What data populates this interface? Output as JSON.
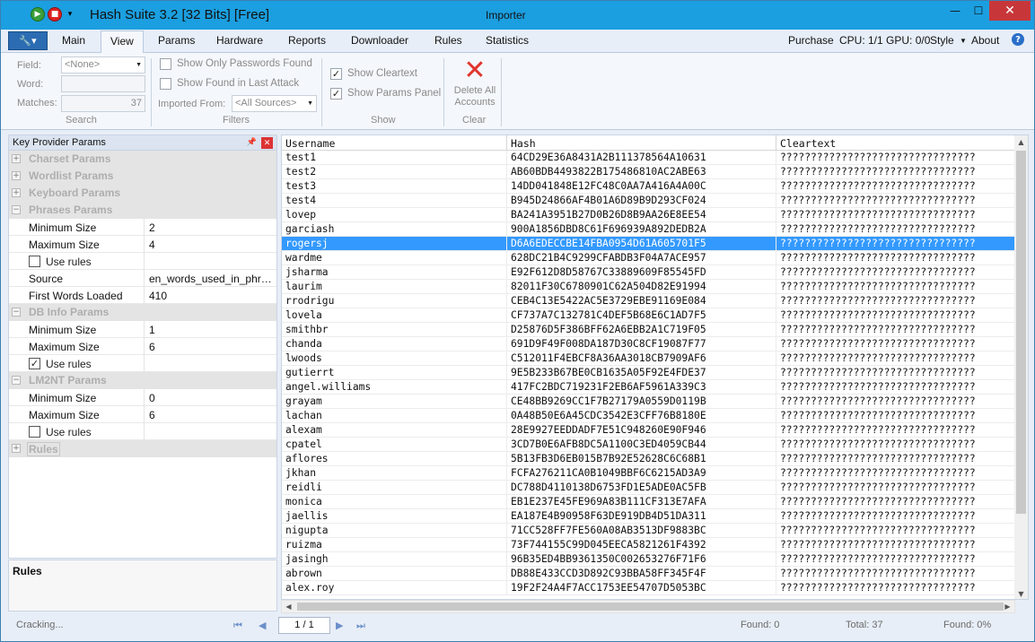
{
  "titlebar": {
    "app_title": "Hash Suite 3.2 [32 Bits] [Free]",
    "center_title": "Importer",
    "minimize": "—",
    "maximize": "☐",
    "close": "✕"
  },
  "menu": {
    "app_button_icon": "key-icon",
    "tabs": [
      "Main",
      "View",
      "Params",
      "Hardware",
      "Reports",
      "Downloader",
      "Rules",
      "Statistics"
    ],
    "active_tab": "View",
    "purchase": "Purchase",
    "cpu_gpu": "CPU: 1/1 GPU: 0/0",
    "style": "Style",
    "about": "About",
    "help": "?"
  },
  "ribbon": {
    "search": {
      "field_label": "Field:",
      "field_value": "<None>",
      "word_label": "Word:",
      "word_value": "",
      "matches_label": "Matches:",
      "matches_value": "37",
      "group": "Search"
    },
    "filters": {
      "show_only_found": "Show Only Passwords Found",
      "show_only_found_checked": false,
      "show_found_last": "Show Found in Last Attack",
      "show_found_last_checked": false,
      "imported_from_label": "Imported From:",
      "imported_from_value": "<All Sources>",
      "group": "Filters"
    },
    "show": {
      "show_cleartext": "Show Cleartext",
      "show_cleartext_checked": true,
      "show_params_panel": "Show Params Panel",
      "show_params_panel_checked": true,
      "group": "Show"
    },
    "clear": {
      "delete_line1": "Delete All",
      "delete_line2": "Accounts",
      "group": "Clear"
    }
  },
  "left_panel": {
    "title": "Key Provider Params",
    "rows": [
      {
        "type": "cat",
        "name": "Charset Params",
        "expander": "+"
      },
      {
        "type": "cat",
        "name": "Wordlist Params",
        "expander": "+"
      },
      {
        "type": "cat",
        "name": "Keyboard Params",
        "expander": "+"
      },
      {
        "type": "cat",
        "name": "Phrases Params",
        "expander": "−"
      },
      {
        "type": "prop",
        "name": "Minimum Size",
        "value": "2"
      },
      {
        "type": "prop",
        "name": "Maximum Size",
        "value": "4"
      },
      {
        "type": "check",
        "name": "Use rules",
        "checked": false
      },
      {
        "type": "prop",
        "name": "Source",
        "value": "en_words_used_in_phrases.lst"
      },
      {
        "type": "prop",
        "name": "First Words Loaded",
        "value": "410"
      },
      {
        "type": "cat",
        "name": "DB Info Params",
        "expander": "−"
      },
      {
        "type": "prop",
        "name": "Minimum Size",
        "value": "1"
      },
      {
        "type": "prop",
        "name": "Maximum Size",
        "value": "6"
      },
      {
        "type": "check",
        "name": "Use rules",
        "checked": true
      },
      {
        "type": "cat",
        "name": "LM2NT Params",
        "expander": "−"
      },
      {
        "type": "prop",
        "name": "Minimum Size",
        "value": "0"
      },
      {
        "type": "prop",
        "name": "Maximum Size",
        "value": "6"
      },
      {
        "type": "check",
        "name": "Use rules",
        "checked": false
      },
      {
        "type": "rulescat",
        "name": "Rules",
        "expander": "+"
      }
    ],
    "bottom_title": "Rules"
  },
  "table": {
    "columns": [
      "Username",
      "Hash",
      "Cleartext"
    ],
    "selected_index": 6,
    "rows": [
      [
        "test1",
        "64CD29E36A8431A2B111378564A10631",
        "????????????????????????????????"
      ],
      [
        "test2",
        "AB60BDB4493822B175486810AC2ABE63",
        "????????????????????????????????"
      ],
      [
        "test3",
        "14DD041848E12FC48C0AA7A416A4A00C",
        "????????????????????????????????"
      ],
      [
        "test4",
        "B945D24866AF4B01A6D89B9D293CF024",
        "????????????????????????????????"
      ],
      [
        "lovep",
        "BA241A3951B27D0B26D8B9AA26E8EE54",
        "????????????????????????????????"
      ],
      [
        "garciash",
        "900A1856DBD8C61F696939A892DEDB2A",
        "????????????????????????????????"
      ],
      [
        "rogersj",
        "D6A6EDECCBE14FBA0954D61A605701F5",
        "????????????????????????????????"
      ],
      [
        "wardme",
        "628DC21B4C9299CFABDB3F04A7ACE957",
        "????????????????????????????????"
      ],
      [
        "jsharma",
        "E92F612D8D58767C33889609F85545FD",
        "????????????????????????????????"
      ],
      [
        "laurim",
        "82011F30C6780901C62A504D82E91994",
        "????????????????????????????????"
      ],
      [
        "rrodrigu",
        "CEB4C13E5422AC5E3729EBE91169E084",
        "????????????????????????????????"
      ],
      [
        "lovela",
        "CF737A7C132781C4DEF5B68E6C1AD7F5",
        "????????????????????????????????"
      ],
      [
        "smithbr",
        "D25876D5F386BFF62A6EBB2A1C719F05",
        "????????????????????????????????"
      ],
      [
        "chanda",
        "691D9F49F008DA187D30C8CF19087F77",
        "????????????????????????????????"
      ],
      [
        "lwoods",
        "C512011F4EBCF8A36AA3018CB7909AF6",
        "????????????????????????????????"
      ],
      [
        "gutierrt",
        "9E5B233B67BE0CB1635A05F92E4FDE37",
        "????????????????????????????????"
      ],
      [
        "angel.williams",
        "417FC2BDC719231F2EB6AF5961A339C3",
        "????????????????????????????????"
      ],
      [
        "grayam",
        "CE48BB9269CC1F7B27179A0559D0119B",
        "????????????????????????????????"
      ],
      [
        "lachan",
        "0A48B50E6A45CDC3542E3CFF76B8180E",
        "????????????????????????????????"
      ],
      [
        "alexam",
        "28E9927EEDDADF7E51C948260E90F946",
        "????????????????????????????????"
      ],
      [
        "cpatel",
        "3CD7B0E6AFB8DC5A1100C3ED4059CB44",
        "????????????????????????????????"
      ],
      [
        "aflores",
        "5B13FB3D6EB015B7B92E52628C6C68B1",
        "????????????????????????????????"
      ],
      [
        "jkhan",
        "FCFA276211CA0B1049BBF6C6215AD3A9",
        "????????????????????????????????"
      ],
      [
        "reidli",
        "DC788D4110138D6753FD1E5ADE0AC5FB",
        "????????????????????????????????"
      ],
      [
        "monica",
        "EB1E237E45FE969A83B111CF313E7AFA",
        "????????????????????????????????"
      ],
      [
        "jaellis",
        "EA187E4B90958F63DE919DB4D51DA311",
        "????????????????????????????????"
      ],
      [
        "nigupta",
        "71CC528FF7FE560A08AB3513DF9883BC",
        "????????????????????????????????"
      ],
      [
        "ruizma",
        "73F744155C99D045EECA5821261F4392",
        "????????????????????????????????"
      ],
      [
        "jasingh",
        "96B35ED4BB9361350C002653276F71F6",
        "????????????????????????????????"
      ],
      [
        "abrown",
        "DB88E433CCD3D892C93BBA58FF345F4F",
        "????????????????????????????????"
      ],
      [
        "alex.roy",
        "19F2F24A4F7ACC1753EE54707D5053BC",
        "????????????????????????????????"
      ]
    ]
  },
  "status": {
    "state": "Cracking...",
    "page": "1 / 1",
    "found": "Found: 0",
    "total": "Total: 37",
    "found_pct": "Found: 0%"
  },
  "colors": {
    "titlebar": "#1b9fe0",
    "selection": "#3399ff",
    "delete_icon": "#e0342c"
  }
}
